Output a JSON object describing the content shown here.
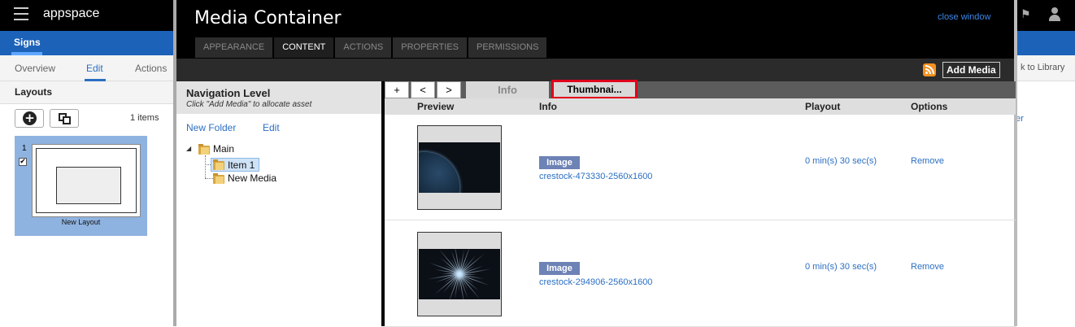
{
  "app": {
    "logo": "appspace",
    "section": "Signs"
  },
  "subnav": {
    "overview": "Overview",
    "edit": "Edit",
    "actions": "Actions",
    "to_library": "k to Library"
  },
  "layouts": {
    "title": "Layouts",
    "count": "1 items",
    "card_number": "1",
    "card_label": "New Layout"
  },
  "background": {
    "right_link": "ner"
  },
  "modal": {
    "title": "Media Container",
    "close": "close window",
    "tabs": [
      {
        "label": "APPEARANCE"
      },
      {
        "label": "CONTENT"
      },
      {
        "label": "ACTIONS"
      },
      {
        "label": "PROPERTIES"
      },
      {
        "label": "PERMISSIONS"
      }
    ],
    "active_tab": "CONTENT",
    "add_media": "Add Media"
  },
  "nav": {
    "title": "Navigation Level",
    "subtitle": "Click \"Add Media\" to allocate asset",
    "new_folder": "New Folder",
    "edit": "Edit",
    "tree": {
      "root": "Main",
      "item1": "Item 1",
      "new_media": "New Media"
    }
  },
  "content": {
    "controls": {
      "add": "+",
      "prev": "<",
      "next": ">"
    },
    "view_info": "Info",
    "view_thumbnail": "Thumbnai...",
    "columns": {
      "preview": "Preview",
      "info": "Info",
      "playout": "Playout",
      "options": "Options"
    },
    "rows": [
      {
        "type": "Image",
        "filename": "crestock-473330-2560x1600",
        "playout": "0 min(s) 30 sec(s)",
        "option": "Remove",
        "preview": "planet"
      },
      {
        "type": "Image",
        "filename": "crestock-294906-2560x1600",
        "playout": "0 min(s) 30 sec(s)",
        "option": "Remove",
        "preview": "firework"
      }
    ]
  },
  "colors": {
    "accent": "#1c62b9",
    "link": "#2c6fc2",
    "highlight_border": "#e0001b",
    "badge": "#6d82b5"
  }
}
